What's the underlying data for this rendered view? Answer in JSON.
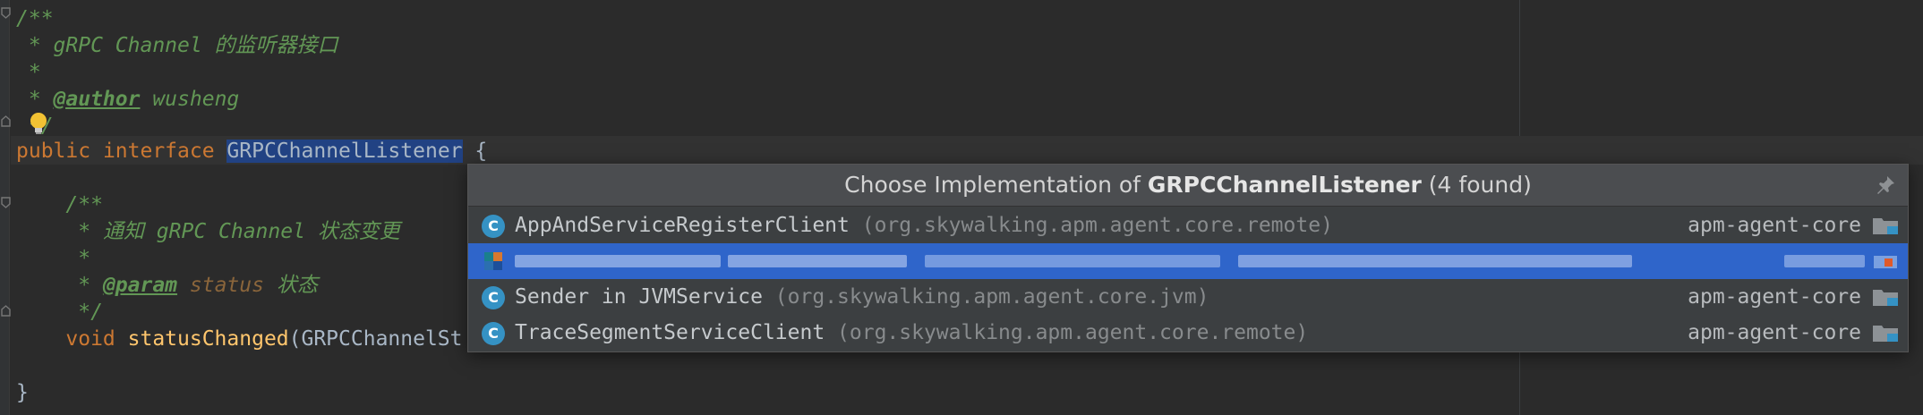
{
  "editor": {
    "lines": {
      "doc_open": "/**",
      "doc_star": " * ",
      "doc_title": "gRPC Channel 的监听器接口",
      "doc_blank": " *",
      "author_tag": "@author",
      "author_name": " wusheng",
      "doc_close": " */",
      "kw_public": "public",
      "kw_interface": " interface ",
      "interface_name": "GRPCChannelListener",
      "brace_open": " {",
      "inner_doc_open": "    /**",
      "inner_doc_star": "     * ",
      "inner_doc_desc": "通知 gRPC Channel 状态变更",
      "inner_doc_blank": "     *",
      "param_tag": "@param",
      "param_name": "status",
      "param_desc": " 状态",
      "inner_doc_close": "     */",
      "kw_void": "    void ",
      "method_name": "statusChanged",
      "method_args": "(GRPCChannelSt",
      "brace_close": "}"
    }
  },
  "popup": {
    "title_prefix": "Choose Implementation of ",
    "title_bold": "GRPCChannelListener",
    "title_suffix": " (4 found)",
    "items": [
      {
        "icon": "C",
        "name": "AppAndServiceRegisterClient",
        "package": " (org.skywalking.apm.agent.core.remote)",
        "module": "apm-agent-core"
      },
      {
        "icon": "",
        "name": "",
        "package": "",
        "module": ""
      },
      {
        "icon": "C",
        "name": "Sender in JVMService",
        "package": " (org.skywalking.apm.agent.core.jvm)",
        "module": "apm-agent-core"
      },
      {
        "icon": "C",
        "name": "TraceSegmentServiceClient",
        "package": " (org.skywalking.apm.agent.core.remote)",
        "module": "apm-agent-core"
      }
    ]
  },
  "colors": {
    "editor_bg": "#2b2b2b",
    "doc_comment": "#629755",
    "keyword": "#cc7832",
    "method": "#ffc66d",
    "selection": "#214283",
    "popup_selected_row": "#2f65ca",
    "class_icon": "#3592c4"
  },
  "icons": [
    "fold-marker-icon",
    "lightbulb-icon",
    "pin-icon",
    "class-icon",
    "module-folder-icon"
  ]
}
